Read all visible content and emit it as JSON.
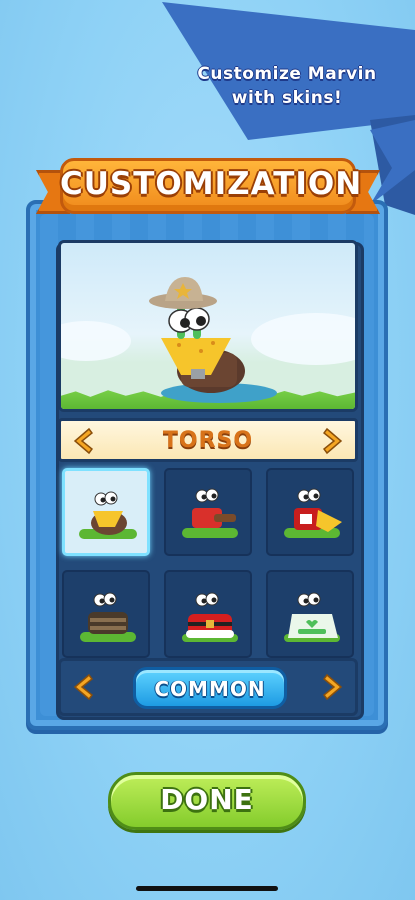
{
  "promo": {
    "text": "Customize Marvin\nwith skins!"
  },
  "title": "CUSTOMIZATION",
  "category": {
    "label": "TORSO"
  },
  "rarity": {
    "label": "COMMON"
  },
  "done_label": "DONE",
  "items": [
    {
      "name": "cowboy-vest",
      "selected": true
    },
    {
      "name": "red-guitar"
    },
    {
      "name": "mustard-cape"
    },
    {
      "name": "barrel-armor"
    },
    {
      "name": "santa-suit"
    },
    {
      "name": "i-love-slime-shirt"
    }
  ],
  "colors": {
    "background": "#8fd2f6",
    "panel": "#234a7a",
    "ribbon": "#f08a1c",
    "arrow": "#f5a623",
    "common_button": "#1e9be3",
    "done_button": "#84cc2c"
  }
}
